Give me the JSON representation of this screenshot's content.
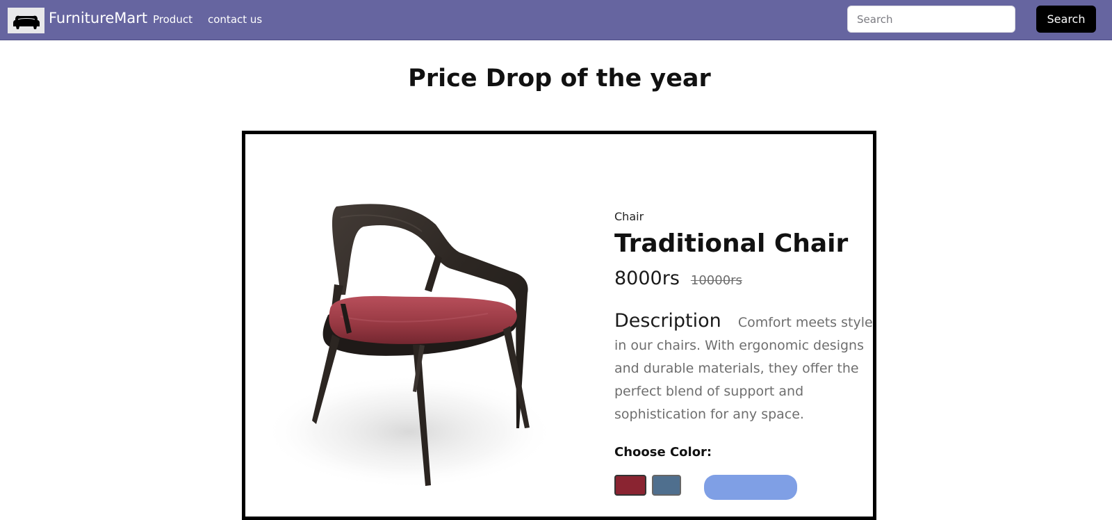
{
  "navbar": {
    "brand_name": "FurnitureMart",
    "logo_icon": "sofa-icon",
    "links": [
      "Product",
      "contact us"
    ],
    "search_placeholder": "Search",
    "search_button_label": "Search",
    "background_color": "#6665a0"
  },
  "page": {
    "heading": "Price Drop of the year"
  },
  "product": {
    "category": "Chair",
    "title": "Traditional Chair",
    "price": "8000rs",
    "original_price": "10000rs",
    "description_label": "Description",
    "description_text": "Comfort meets style in our chairs. With ergonomic designs and durable materials, they offer the perfect blend of support and sophistication for any space.",
    "choose_color_label": "Choose Color:",
    "colors": [
      "#8a2431",
      "#4f6f8e"
    ],
    "accent_button_color": "#7f9fe5"
  }
}
